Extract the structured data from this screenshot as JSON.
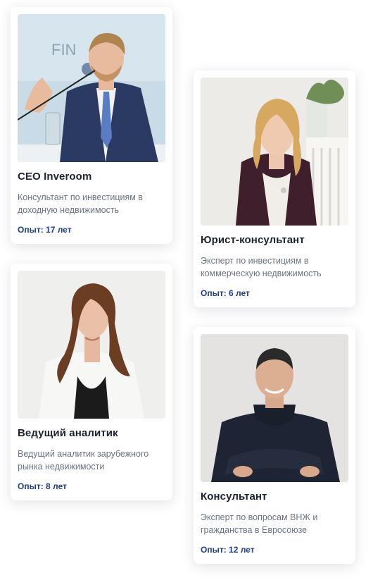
{
  "cards": [
    {
      "title": "CEO Inveroom",
      "description": "Консультант по инвестициям в доходную недвижимость",
      "experience": "Опыт: 17 лет",
      "photo_background_text": "FIN"
    },
    {
      "title": "Юрист-консультант",
      "description": "Эксперт по инвестициям в коммерческую недвижимость",
      "experience": "Опыт: 6 лет"
    },
    {
      "title": "Ведущий аналитик",
      "description": "Ведущий аналитик зарубежного рынка недвижимости",
      "experience": "Опыт: 8 лет"
    },
    {
      "title": "Консультант",
      "description": "Эксперт по вопросам ВНЖ и гражданства в Евросоюзе",
      "experience": "Опыт: 12 лет"
    }
  ],
  "colors": {
    "title": "#1c2230",
    "description": "#6b7485",
    "experience": "#1f3d8a"
  }
}
